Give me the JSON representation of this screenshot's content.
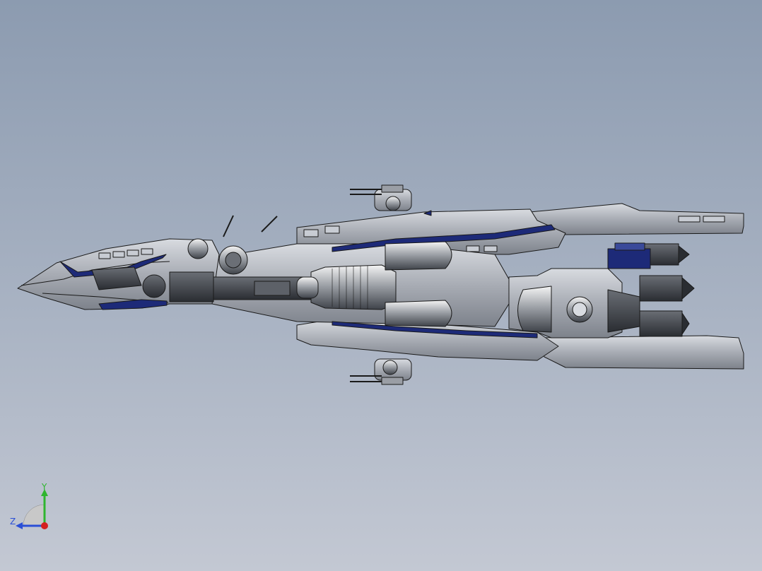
{
  "viewport": {
    "background_top": "#8c9bb0",
    "background_bottom": "#c3c8d3"
  },
  "model": {
    "hull_color": "#b4b8bf",
    "stripe_color": "#1d2a78",
    "dark_color": "#4a4e56",
    "edge_color": "#1a1a1a"
  },
  "triad": {
    "y_label": "Y",
    "z_label": "Z",
    "y_color": "#2fb52f",
    "z_color": "#2b4fd6",
    "x_color": "#d42020"
  }
}
